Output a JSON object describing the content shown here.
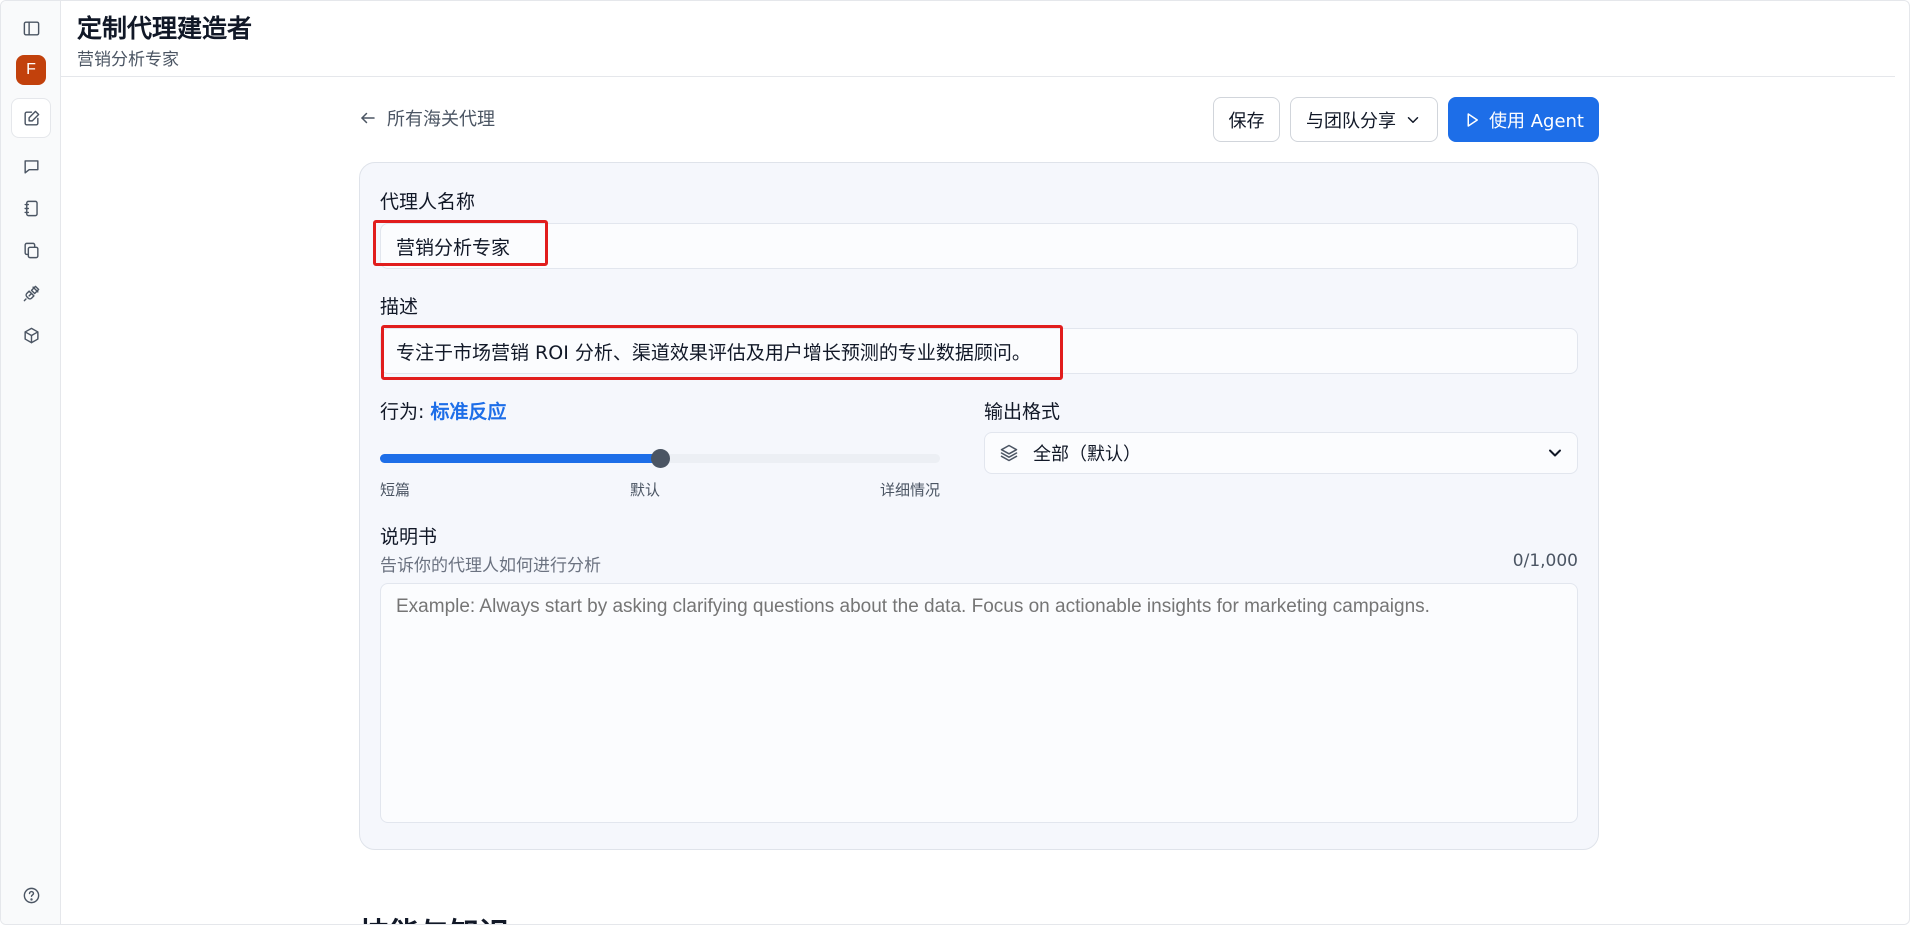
{
  "header": {
    "title": "定制代理建造者",
    "subtitle": "营销分析专家"
  },
  "sidebar": {
    "avatar_letter": "F",
    "icons": [
      "sidebar-toggle-icon",
      "edit-icon",
      "chat-icon",
      "notebook-icon",
      "copy-icon",
      "plug-icon",
      "cube-icon",
      "help-icon"
    ]
  },
  "topbar": {
    "back_label": "所有海关代理",
    "save_label": "保存",
    "share_label": "与团队分享",
    "use_agent_label": "使用 Agent"
  },
  "form": {
    "name_label": "代理人名称",
    "name_value": "营销分析专家",
    "description_label": "描述",
    "description_value": "专注于市场营销 ROI 分析、渠道效果评估及用户增长预测的专业数据顾问。",
    "behavior_label": "行为:",
    "behavior_value": "标准反应",
    "behavior_level": 0.5,
    "slider_ticks": [
      "短篇",
      "默认",
      "详细情况"
    ],
    "output_format_label": "输出格式",
    "output_format_value": "全部（默认）",
    "instructions_label": "说明书",
    "instructions_helper": "告诉你的代理人如何进行分析",
    "instructions_count": "0/1,000",
    "instructions_placeholder": "Example: Always start by asking clarifying questions about the data. Focus on actionable insights for marketing campaigns."
  },
  "next_section_title": "技能与知识",
  "colors": {
    "primary": "#1d6ee8",
    "highlight": "#e11d1d",
    "avatar": "#c2410c"
  }
}
